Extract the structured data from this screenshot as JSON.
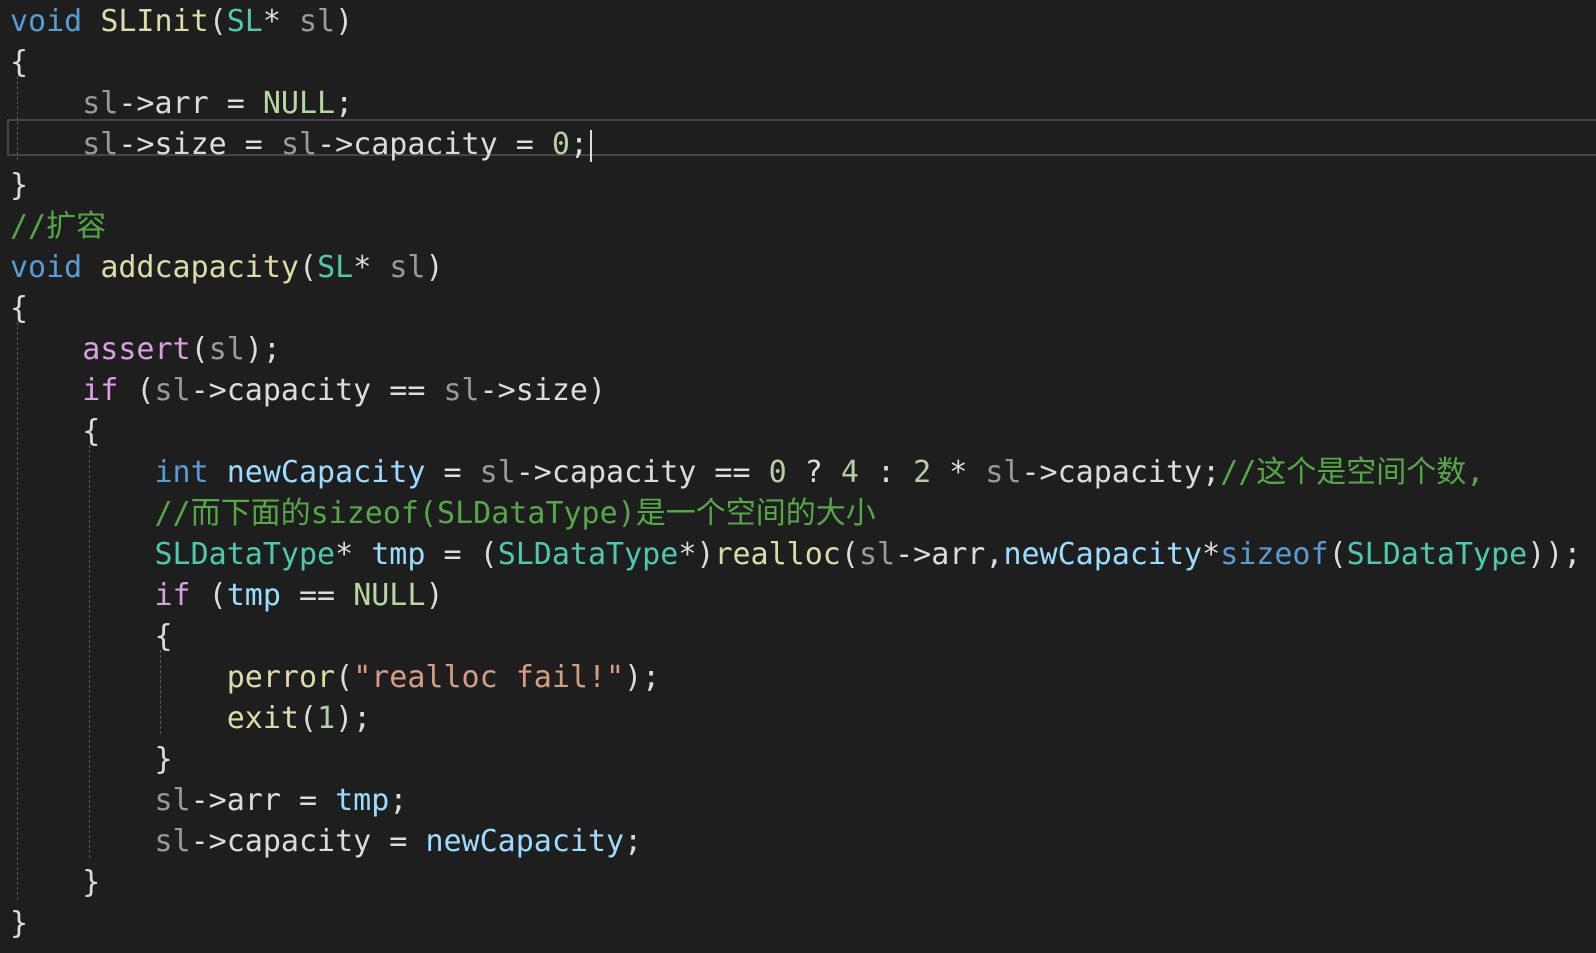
{
  "editor": {
    "colors": {
      "background": "#1e1e1e",
      "keyword": "#569cd6",
      "function": "#dcdcaa",
      "type": "#4ec9b0",
      "param": "#9a9a9a",
      "variable": "#9cdcfe",
      "macro": "#b8d7a3",
      "number": "#b5cea8",
      "string": "#d69d85",
      "comment": "#57a64a",
      "control": "#d8a0df",
      "plain": "#dcdcdc"
    },
    "lines": [
      [
        {
          "t": "void",
          "c": "keyword"
        },
        {
          "t": " "
        },
        {
          "t": "SLInit",
          "c": "function"
        },
        {
          "t": "("
        },
        {
          "t": "SL",
          "c": "type"
        },
        {
          "t": "* "
        },
        {
          "t": "sl",
          "c": "param"
        },
        {
          "t": ")"
        }
      ],
      [
        {
          "t": "{"
        }
      ],
      [
        {
          "t": "    "
        },
        {
          "t": "sl",
          "c": "param"
        },
        {
          "t": "->"
        },
        {
          "t": "arr"
        },
        {
          "t": " = "
        },
        {
          "t": "NULL",
          "c": "macro"
        },
        {
          "t": ";"
        }
      ],
      [
        {
          "t": "    "
        },
        {
          "t": "sl",
          "c": "param"
        },
        {
          "t": "->"
        },
        {
          "t": "size"
        },
        {
          "t": " = "
        },
        {
          "t": "sl",
          "c": "param"
        },
        {
          "t": "->"
        },
        {
          "t": "capacity"
        },
        {
          "t": " = "
        },
        {
          "t": "0",
          "c": "number"
        },
        {
          "t": ";"
        }
      ],
      [
        {
          "t": "}"
        }
      ],
      [
        {
          "t": "//扩容",
          "c": "comment"
        }
      ],
      [
        {
          "t": "void",
          "c": "keyword"
        },
        {
          "t": " "
        },
        {
          "t": "addcapacity",
          "c": "function"
        },
        {
          "t": "("
        },
        {
          "t": "SL",
          "c": "type"
        },
        {
          "t": "* "
        },
        {
          "t": "sl",
          "c": "param"
        },
        {
          "t": ")"
        }
      ],
      [
        {
          "t": "{"
        }
      ],
      [
        {
          "t": "    "
        },
        {
          "t": "assert",
          "c": "control"
        },
        {
          "t": "("
        },
        {
          "t": "sl",
          "c": "param"
        },
        {
          "t": ");"
        }
      ],
      [
        {
          "t": "    "
        },
        {
          "t": "if",
          "c": "control"
        },
        {
          "t": " ("
        },
        {
          "t": "sl",
          "c": "param"
        },
        {
          "t": "->"
        },
        {
          "t": "capacity"
        },
        {
          "t": " == "
        },
        {
          "t": "sl",
          "c": "param"
        },
        {
          "t": "->"
        },
        {
          "t": "size"
        },
        {
          "t": ")"
        }
      ],
      [
        {
          "t": "    {"
        }
      ],
      [
        {
          "t": "        "
        },
        {
          "t": "int",
          "c": "keyword"
        },
        {
          "t": " "
        },
        {
          "t": "newCapacity",
          "c": "variable"
        },
        {
          "t": " = "
        },
        {
          "t": "sl",
          "c": "param"
        },
        {
          "t": "->"
        },
        {
          "t": "capacity"
        },
        {
          "t": " == "
        },
        {
          "t": "0",
          "c": "number"
        },
        {
          "t": " ? "
        },
        {
          "t": "4",
          "c": "number"
        },
        {
          "t": " : "
        },
        {
          "t": "2",
          "c": "number"
        },
        {
          "t": " * "
        },
        {
          "t": "sl",
          "c": "param"
        },
        {
          "t": "->"
        },
        {
          "t": "capacity"
        },
        {
          "t": ";"
        },
        {
          "t": "//这个是空间个数,",
          "c": "comment"
        }
      ],
      [
        {
          "t": "        "
        },
        {
          "t": "//而下面的sizeof(SLDataType)是一个空间的大小",
          "c": "comment"
        }
      ],
      [
        {
          "t": "        "
        },
        {
          "t": "SLDataType",
          "c": "type"
        },
        {
          "t": "* "
        },
        {
          "t": "tmp",
          "c": "variable"
        },
        {
          "t": " = ("
        },
        {
          "t": "SLDataType",
          "c": "type"
        },
        {
          "t": "*)"
        },
        {
          "t": "realloc",
          "c": "function"
        },
        {
          "t": "("
        },
        {
          "t": "sl",
          "c": "param"
        },
        {
          "t": "->"
        },
        {
          "t": "arr"
        },
        {
          "t": ","
        },
        {
          "t": "newCapacity",
          "c": "variable"
        },
        {
          "t": "*"
        },
        {
          "t": "sizeof",
          "c": "keyword"
        },
        {
          "t": "("
        },
        {
          "t": "SLDataType",
          "c": "type"
        },
        {
          "t": "));"
        }
      ],
      [
        {
          "t": "        "
        },
        {
          "t": "if",
          "c": "control"
        },
        {
          "t": " ("
        },
        {
          "t": "tmp",
          "c": "variable"
        },
        {
          "t": " == "
        },
        {
          "t": "NULL",
          "c": "macro"
        },
        {
          "t": ")"
        }
      ],
      [
        {
          "t": "        {"
        }
      ],
      [
        {
          "t": "            "
        },
        {
          "t": "perror",
          "c": "function"
        },
        {
          "t": "("
        },
        {
          "t": "\"realloc fail!\"",
          "c": "string"
        },
        {
          "t": ");"
        }
      ],
      [
        {
          "t": "            "
        },
        {
          "t": "exit",
          "c": "function"
        },
        {
          "t": "("
        },
        {
          "t": "1",
          "c": "number"
        },
        {
          "t": ");"
        }
      ],
      [
        {
          "t": "        }"
        }
      ],
      [
        {
          "t": "        "
        },
        {
          "t": "sl",
          "c": "param"
        },
        {
          "t": "->"
        },
        {
          "t": "arr"
        },
        {
          "t": " = "
        },
        {
          "t": "tmp",
          "c": "variable"
        },
        {
          "t": ";"
        }
      ],
      [
        {
          "t": "        "
        },
        {
          "t": "sl",
          "c": "param"
        },
        {
          "t": "->"
        },
        {
          "t": "capacity"
        },
        {
          "t": " = "
        },
        {
          "t": "newCapacity",
          "c": "variable"
        },
        {
          "t": ";"
        }
      ],
      [
        {
          "t": "    }"
        }
      ],
      [
        {
          "t": "}"
        }
      ]
    ]
  }
}
